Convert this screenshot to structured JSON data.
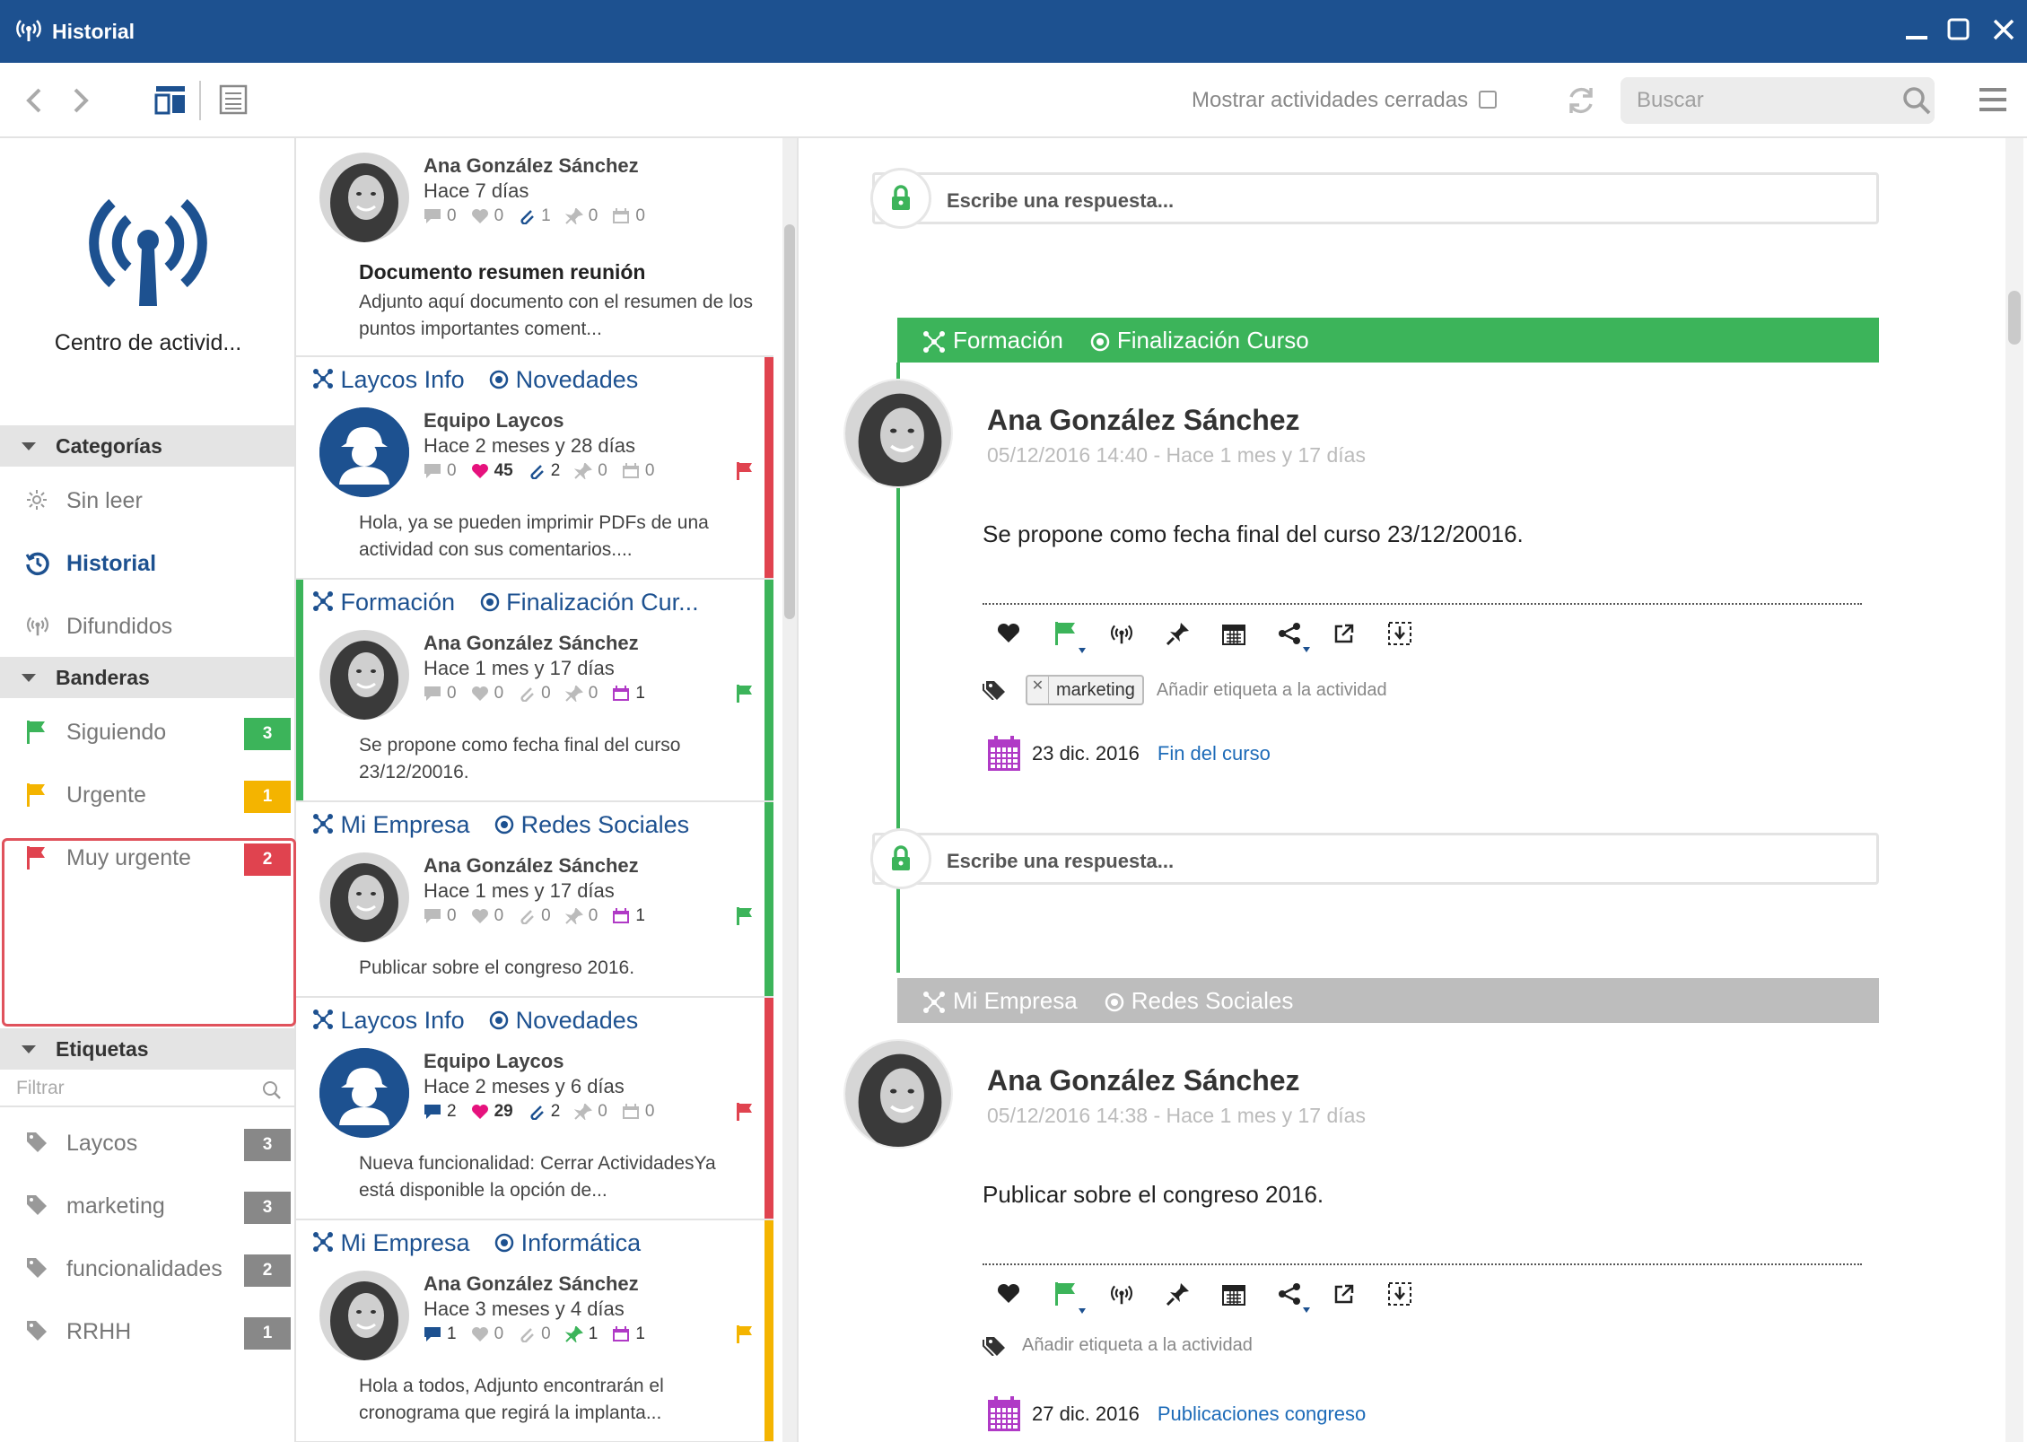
{
  "window": {
    "title": "Historial"
  },
  "toolbar": {
    "show_closed_label": "Mostrar actividades cerradas",
    "search_placeholder": "Buscar"
  },
  "sidebar": {
    "title": "Centro de activid...",
    "sections": {
      "categorias": "Categorías",
      "banderas": "Banderas",
      "etiquetas": "Etiquetas"
    },
    "categorias": [
      {
        "label": "Sin leer",
        "icon": "sun-icon"
      },
      {
        "label": "Historial",
        "icon": "history-icon",
        "active": true
      },
      {
        "label": "Difundidos",
        "icon": "broadcast-icon"
      }
    ],
    "banderas": [
      {
        "label": "Siguiendo",
        "count": "3",
        "color": "#3cb45a"
      },
      {
        "label": "Urgente",
        "count": "1",
        "color": "#f4b400"
      },
      {
        "label": "Muy urgente",
        "count": "2",
        "color": "#e0434f"
      }
    ],
    "filter_placeholder": "Filtrar",
    "etiquetas": [
      {
        "label": "Laycos",
        "count": "3"
      },
      {
        "label": "marketing",
        "count": "3"
      },
      {
        "label": "funcionalidades",
        "count": "2"
      },
      {
        "label": "RRHH",
        "count": "1"
      }
    ]
  },
  "list": [
    {
      "author": "Ana González Sánchez",
      "time": "Hace 7 días",
      "stats": [
        "0",
        "0",
        "1",
        "0",
        "0"
      ],
      "title": "Documento resumen reunión",
      "body": "Adjunto aquí documento con el resumen de los puntos importantes coment..."
    },
    {
      "category": "Laycos Info",
      "subcategory": "Novedades",
      "author": "Equipo Laycos",
      "time": "Hace 2 meses y 28 días",
      "stats": [
        "0",
        "45",
        "2",
        "0",
        "0"
      ],
      "body": "Hola, ya se pueden imprimir PDFs de una actividad con sus comentarios....",
      "flag_color": "#e0434f"
    },
    {
      "category": "Formación",
      "subcategory": "Finalización Cur...",
      "author": "Ana González Sánchez",
      "time": "Hace 1 mes y 17 días",
      "stats": [
        "0",
        "0",
        "0",
        "0",
        "1"
      ],
      "body": "Se propone como fecha final del curso 23/12/20016.",
      "flag_color": "#3cb45a"
    },
    {
      "category": "Mi Empresa",
      "subcategory": "Redes Sociales",
      "author": "Ana González Sánchez",
      "time": "Hace 1 mes y 17 días",
      "stats": [
        "0",
        "0",
        "0",
        "0",
        "1"
      ],
      "body": "Publicar sobre el congreso 2016.",
      "flag_color": "#3cb45a"
    },
    {
      "category": "Laycos Info",
      "subcategory": "Novedades",
      "author": "Equipo Laycos",
      "time": "Hace 2 meses y 6 días",
      "stats": [
        "2",
        "29",
        "2",
        "0",
        "0"
      ],
      "body": "Nueva funcionalidad: Cerrar ActividadesYa está disponible la opción de...",
      "flag_color": "#e0434f"
    },
    {
      "category": "Mi Empresa",
      "subcategory": "Informática",
      "author": "Ana González Sánchez",
      "time": "Hace 3 meses y 4 días",
      "stats": [
        "1",
        "0",
        "0",
        "1",
        "1"
      ],
      "body": "Hola a todos, Adjunto encontrarán el cronograma que regirá la implanta...",
      "flag_color": "#f4b400"
    }
  ],
  "detail": {
    "reply_placeholder": "Escribe una respuesta...",
    "activities": [
      {
        "category": "Formación",
        "subcategory": "Finalización Curso",
        "header_color": "#3cb45a",
        "author": "Ana González Sánchez",
        "date": "05/12/2016 14:40 - Hace 1 mes y 17 días",
        "text": "Se propone como fecha final del curso 23/12/20016.",
        "tag": "marketing",
        "add_tag": "Añadir etiqueta a la actividad",
        "event_date": "23 dic. 2016",
        "event_name": "Fin del curso"
      },
      {
        "category": "Mi Empresa",
        "subcategory": "Redes Sociales",
        "header_color": "#bdbdbd",
        "author": "Ana González Sánchez",
        "date": "05/12/2016 14:38 - Hace 1 mes y 17 días",
        "text": "Publicar sobre el congreso 2016.",
        "add_tag": "Añadir etiqueta a la actividad",
        "event_date": "27 dic. 2016",
        "event_name": "Publicaciones congreso"
      }
    ]
  },
  "colors": {
    "brand": "#1d5190",
    "green": "#3cb45a",
    "red": "#e0434f",
    "yellow": "#f4b400",
    "calendar": "#b03ac6"
  }
}
